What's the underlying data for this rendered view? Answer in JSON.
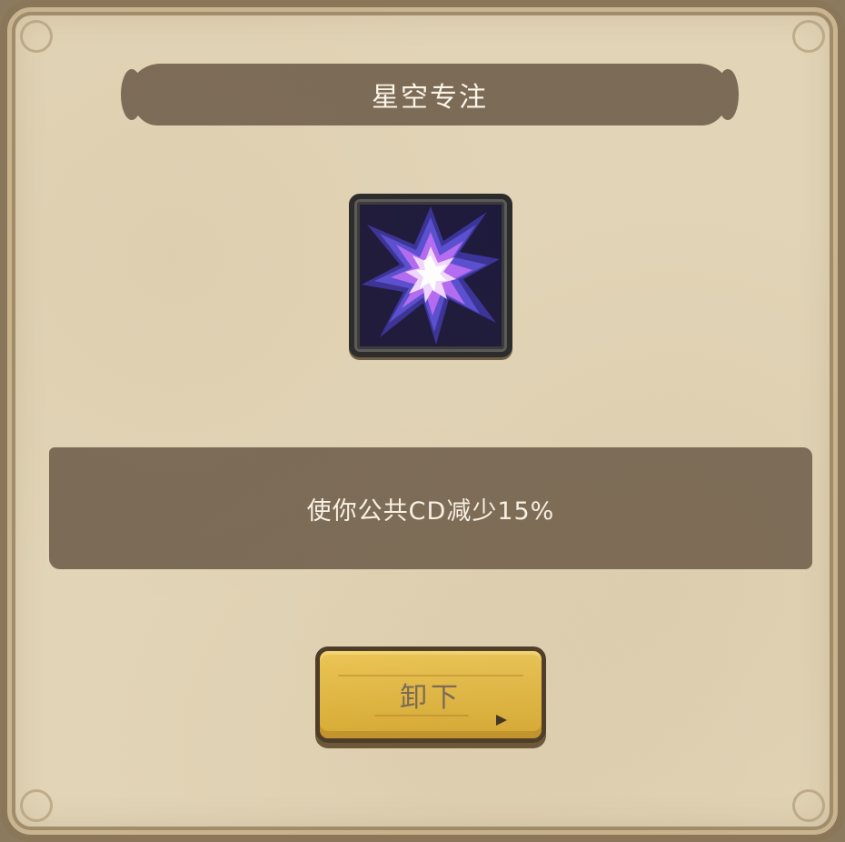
{
  "dialog": {
    "title": "星空专注",
    "skill_icon": "star-burst-icon",
    "description": "使你公共CD减少15%",
    "unequip_label": "卸下"
  },
  "colors": {
    "panel_bg": "#e2d4b6",
    "banner_bg": "#7c6b57",
    "button_bg": "#e6bd46",
    "icon_accent": "#b46cf2"
  }
}
